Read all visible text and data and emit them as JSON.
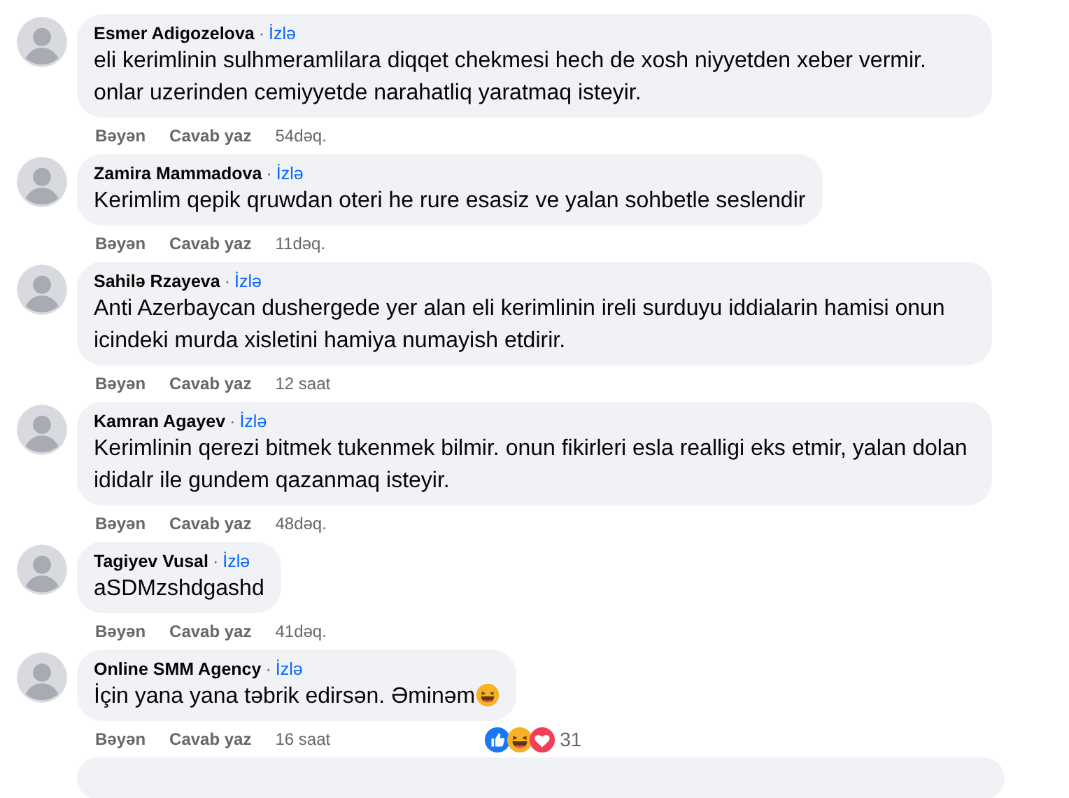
{
  "comments": [
    {
      "author": "Esmer Adigozelova",
      "separator": "·",
      "follow": "İzlə",
      "text": "eli kerimlinin sulhmeramlilara diqqet chekmesi hech de xosh niyyetden xeber vermir. onlar uzerinden cemiyyetde narahatliq yaratmaq isteyir.",
      "actions": [
        "Bəyən",
        "Cavab yaz"
      ],
      "time": "54dəq."
    },
    {
      "author": "Zamira Mammadova",
      "separator": "·",
      "follow": "İzlə",
      "text": "Kerimlim qepik qruwdan oteri he rure esasiz ve yalan sohbetle seslendir",
      "actions": [
        "Bəyən",
        "Cavab yaz"
      ],
      "time": "11dəq."
    },
    {
      "author": "Sahilə Rzayeva",
      "separator": "·",
      "follow": "İzlə",
      "text": "Anti Azerbaycan dushergede yer alan eli kerimlinin ireli surduyu iddialarin hamisi onun icindeki murda xisletini hamiya numayish etdirir.",
      "actions": [
        "Bəyən",
        "Cavab yaz"
      ],
      "time": "12 saat"
    },
    {
      "author": "Kamran Agayev",
      "separator": "·",
      "follow": "İzlə",
      "text": "Kerimlinin qerezi bitmek tukenmek bilmir. onun fikirleri esla realligi eks etmir, yalan dolan ididalr ile gundem qazanmaq isteyir.",
      "actions": [
        "Bəyən",
        "Cavab yaz"
      ],
      "time": "48dəq."
    },
    {
      "author": "Tagiyev Vusal",
      "separator": "·",
      "follow": "İzlə",
      "text": "aSDMzshdgashd",
      "actions": [
        "Bəyən",
        "Cavab yaz"
      ],
      "time": "41dəq."
    },
    {
      "author": "Online SMM Agency",
      "separator": "·",
      "follow": "İzlə",
      "text": "İçin yana yana təbrik edirsən. Əminəm",
      "text_icon": {
        "kind": "laugh"
      },
      "actions": [
        "Bəyən",
        "Cavab yaz"
      ],
      "time": "16 saat",
      "reactions": [
        {
          "kind": "like"
        },
        {
          "kind": "haha"
        },
        {
          "kind": "love"
        }
      ],
      "reaction_count": "31"
    }
  ]
}
